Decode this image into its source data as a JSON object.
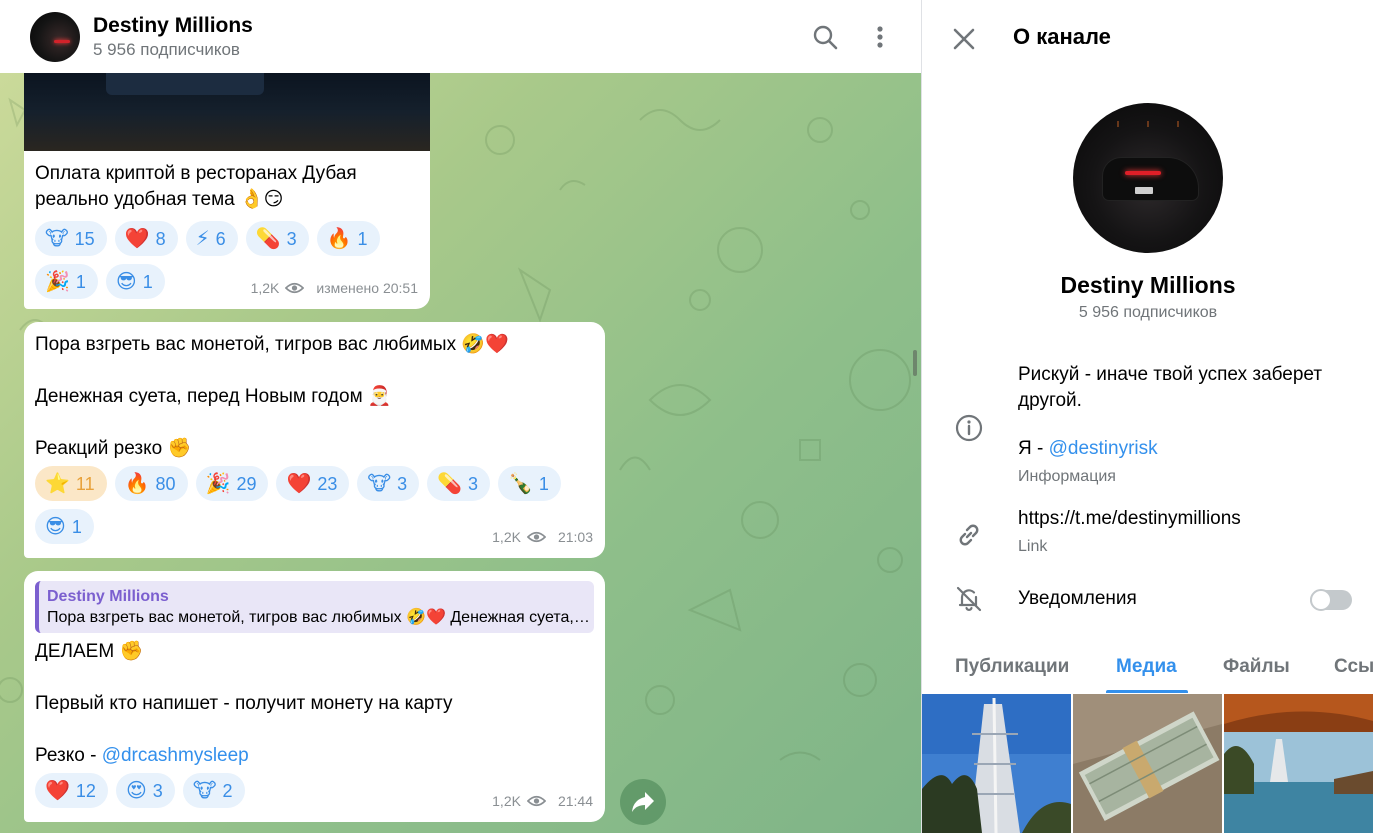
{
  "header": {
    "title": "Destiny Millions",
    "subtitle": "5 956 подписчиков"
  },
  "messages": [
    {
      "text": "Оплата криптой в ресторанах Дубая реально удобная тема 👌😏",
      "reactions": [
        {
          "emoji": "🐮",
          "count": "15"
        },
        {
          "emoji": "❤️",
          "count": "8"
        },
        {
          "emoji": "⚡",
          "count": "6"
        },
        {
          "emoji": "💊",
          "count": "3"
        },
        {
          "emoji": "🔥",
          "count": "1"
        },
        {
          "emoji": "🎉",
          "count": "1"
        },
        {
          "emoji": "😎",
          "count": "1"
        }
      ],
      "views": "1,2K",
      "time": "изменено 20:51"
    },
    {
      "line1": "Пора взгреть вас монетой, тигров вас любимых 🤣❤️",
      "line2": "Денежная суета, перед Новым годом 🎅",
      "line3": "Реакций резко ✊",
      "reactions": [
        {
          "emoji": "⭐",
          "count": "11"
        },
        {
          "emoji": "🔥",
          "count": "80"
        },
        {
          "emoji": "🎉",
          "count": "29"
        },
        {
          "emoji": "❤️",
          "count": "23"
        },
        {
          "emoji": "🐮",
          "count": "3"
        },
        {
          "emoji": "💊",
          "count": "3"
        },
        {
          "emoji": "🍾",
          "count": "1"
        },
        {
          "emoji": "😎",
          "count": "1"
        }
      ],
      "views": "1,2K",
      "time": "21:03"
    },
    {
      "quote_name": "Destiny Millions",
      "quote_text": "Пора взгреть вас монетой, тигров вас любимых 🤣❤️ Денежная суета, перед Новым годом",
      "line1": "ДЕЛАЕМ ✊",
      "line2": "Первый кто напишет - получит монету на карту",
      "line3_prefix": "Резко - ",
      "line3_link": "@drcashmysleep",
      "reactions": [
        {
          "emoji": "❤️",
          "count": "12"
        },
        {
          "emoji": "😍",
          "count": "3"
        },
        {
          "emoji": "🐮",
          "count": "2"
        }
      ],
      "views": "1,2K",
      "time": "21:44"
    }
  ],
  "panel": {
    "title": "О канале",
    "name": "Destiny Millions",
    "subscribers": "5 956 подписчиков",
    "description": "Рискуй - иначе твой успех заберет другой.",
    "me_prefix": "Я - ",
    "me_link": "@destinyrisk",
    "info_label": "Информация",
    "link": "https://t.me/destinymillions",
    "link_label": "Link",
    "notifications_label": "Уведомления",
    "notifications_on": false,
    "tabs": [
      "Публикации",
      "Медиа",
      "Файлы",
      "Ссы"
    ],
    "active_tab": "Медиа"
  },
  "colors": {
    "accent": "#3390ec",
    "reaction_bg": "#e8f2fc",
    "quote_accent": "#7b5fcf"
  },
  "icons": [
    "search-icon",
    "more-vertical-icon",
    "close-icon",
    "info-icon",
    "link-icon",
    "bell-off-icon",
    "eye-icon",
    "share-icon"
  ]
}
